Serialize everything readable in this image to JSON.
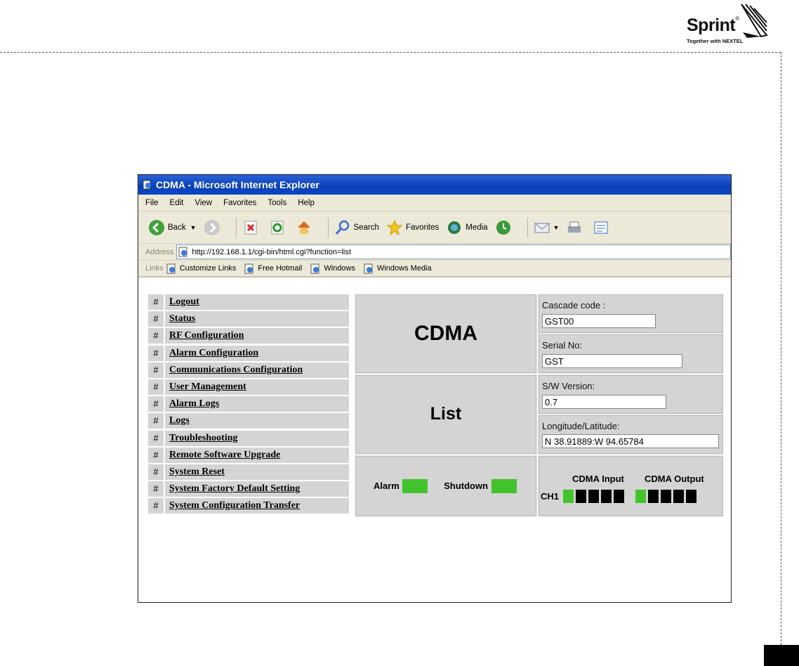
{
  "brand": {
    "name": "Sprint",
    "tagline": "Together with NEXTEL"
  },
  "window": {
    "title": "CDMA - Microsoft Internet Explorer",
    "menu": [
      "File",
      "Edit",
      "View",
      "Favorites",
      "Tools",
      "Help"
    ],
    "toolbar": {
      "back": "Back",
      "search": "Search",
      "favorites": "Favorites",
      "media": "Media"
    },
    "address": {
      "label": "Address",
      "url": "http://192.168.1.1/cgi-bin/html.cgi?function=list"
    },
    "links": {
      "label": "Links",
      "items": [
        "Customize Links",
        "Free Hotmail",
        "Windows",
        "Windows Media"
      ]
    }
  },
  "nav": {
    "marker": "#",
    "items": [
      "Logout",
      "Status",
      "RF Configuration",
      "Alarm Configuration",
      "Communications Configuration",
      "User Management",
      "Alarm Logs",
      "Logs",
      "Troubleshooting",
      "Remote Software Upgrade",
      "System Reset",
      "System Factory Default Setting",
      "System Configuration Transfer"
    ]
  },
  "device": {
    "name": "CDMA",
    "page": "List",
    "cascade_label": "Cascade code :",
    "cascade_value": "GST00",
    "serial_label": "Serial No:",
    "serial_value": "GST",
    "sw_label": "S/W Version:",
    "sw_value": "0.7",
    "geo_label": "Longitude/Latitude:",
    "geo_value": "N 38.91889:W 94.65784"
  },
  "status": {
    "alarm_label": "Alarm",
    "shutdown_label": "Shutdown",
    "input_label": "CDMA Input",
    "output_label": "CDMA Output",
    "channel_label": "CH1",
    "input_leds": [
      true,
      false,
      false,
      false,
      false
    ],
    "output_leds": [
      true,
      false,
      false,
      false,
      false
    ],
    "colors": {
      "on": "#43c32b",
      "off": "#000000"
    }
  }
}
